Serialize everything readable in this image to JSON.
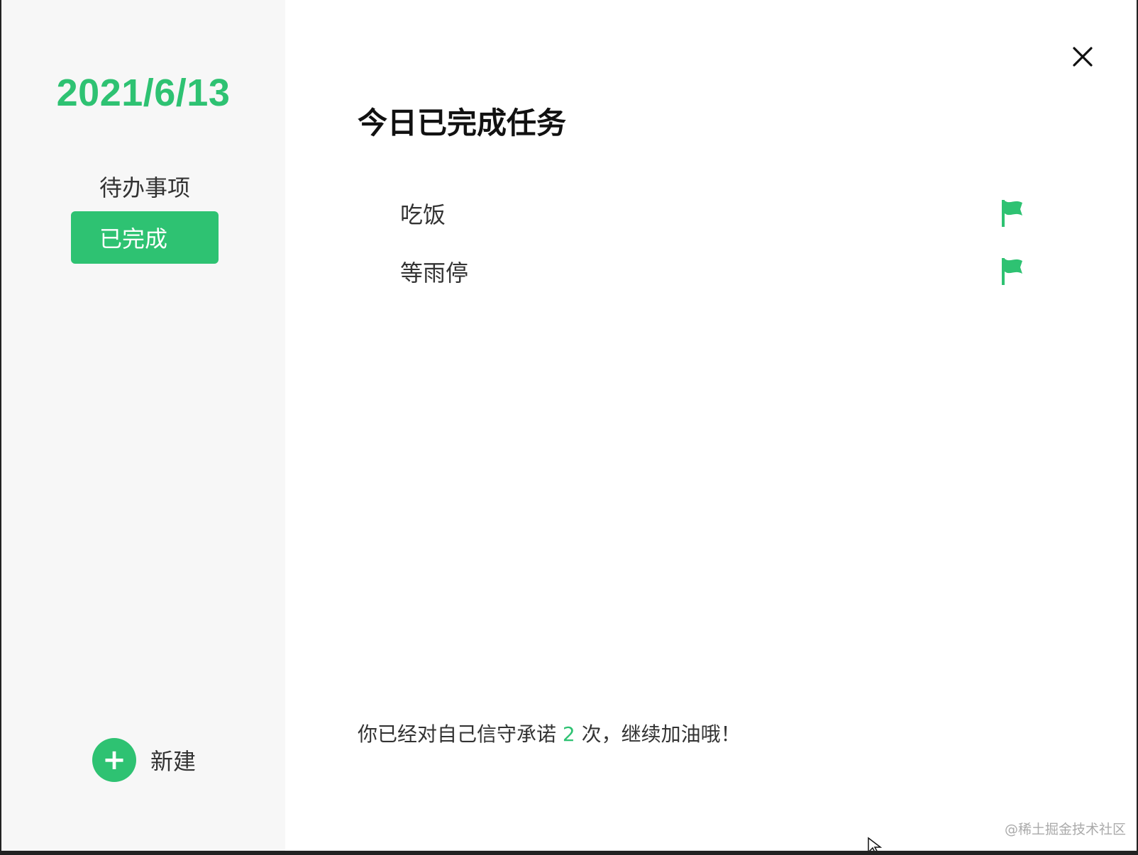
{
  "sidebar": {
    "date": "2021/6/13",
    "nav": [
      {
        "label": "待办事项"
      },
      {
        "label": "已完成"
      }
    ],
    "new_button": {
      "icon": "plus-icon",
      "label": "新建"
    }
  },
  "main": {
    "close_icon": "close-icon",
    "title": "今日已完成任务",
    "tasks": [
      {
        "label": "吃饭",
        "icon": "flag-icon"
      },
      {
        "label": "等雨停",
        "icon": "flag-icon"
      }
    ],
    "footer": {
      "prefix": "你已经对自己信守承诺 ",
      "count": "2",
      "suffix": " 次，继续加油哦！"
    }
  },
  "watermark": "@稀土掘金技术社区",
  "colors": {
    "accent": "#2ec272",
    "sidebar_bg": "#f7f7f7",
    "text": "#333333"
  }
}
